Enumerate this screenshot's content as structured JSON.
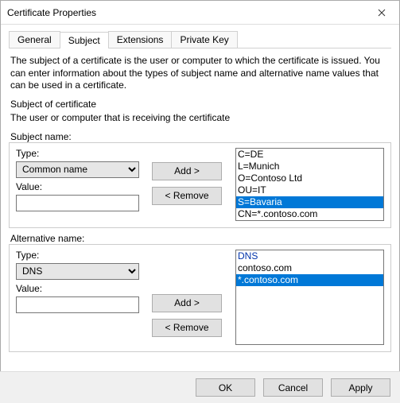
{
  "window": {
    "title": "Certificate Properties"
  },
  "tabs": {
    "general": "General",
    "subject": "Subject",
    "extensions": "Extensions",
    "privatekey": "Private Key"
  },
  "description": "The subject of a certificate is the user or computer to which the certificate is issued. You can enter information about the types of subject name and alternative name values that can be used in a certificate.",
  "subject_heading": "Subject of certificate",
  "subject_sub": "The user or computer that is receiving the certificate",
  "subject_name": {
    "legend": "Subject name:",
    "type_label": "Type:",
    "type_value": "Common name",
    "value_label": "Value:",
    "value_value": "",
    "add": "Add >",
    "remove": "< Remove",
    "list": {
      "i0": "C=DE",
      "i1": "L=Munich",
      "i2": "O=Contoso Ltd",
      "i3": "OU=IT",
      "i4": "S=Bavaria",
      "i5": "CN=*.contoso.com"
    }
  },
  "alt_name": {
    "legend": "Alternative name:",
    "type_label": "Type:",
    "type_value": "DNS",
    "value_label": "Value:",
    "value_value": "",
    "add": "Add >",
    "remove": "< Remove",
    "list": {
      "hd": "DNS",
      "i0": "contoso.com",
      "i1": "*.contoso.com"
    }
  },
  "footer": {
    "ok": "OK",
    "cancel": "Cancel",
    "apply": "Apply"
  }
}
